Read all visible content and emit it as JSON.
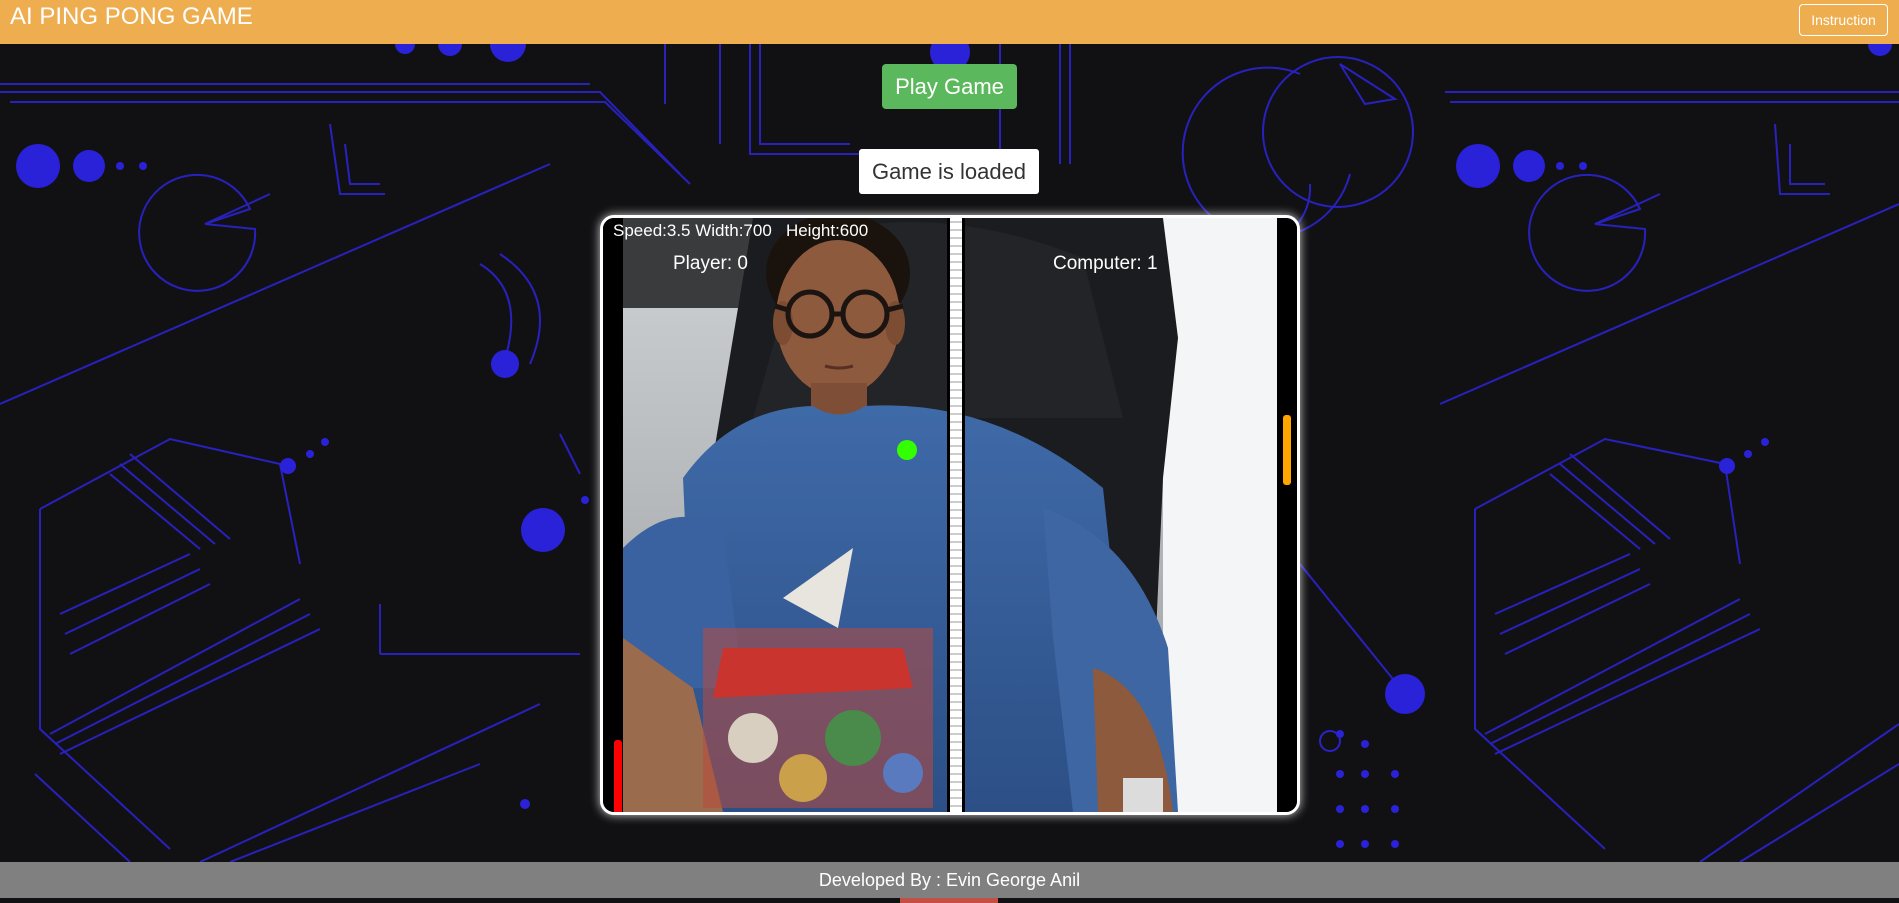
{
  "header": {
    "title": "AI PING PONG GAME",
    "instruction_label": "Instruction"
  },
  "controls": {
    "play_label": "Play Game",
    "status_text": "Game is loaded"
  },
  "game": {
    "stats_text": "Speed:3.5 Width:700   Height:600",
    "player_score_text": "Player: 0",
    "computer_score_text": "Computer: 1",
    "player_paddle_color": "#FF0000",
    "computer_paddle_color": "#FFA500",
    "ball_color": "#33FF00",
    "net_color": "#FFFFFF"
  },
  "footer": {
    "credit_text": "Developed By : Evin George Anil"
  },
  "colors": {
    "header_bg": "#EEAD4F",
    "play_button_bg": "#5CB85C",
    "page_bg": "#111113",
    "circuit_lines": "#2B22C8",
    "footer_bg": "#808080"
  }
}
